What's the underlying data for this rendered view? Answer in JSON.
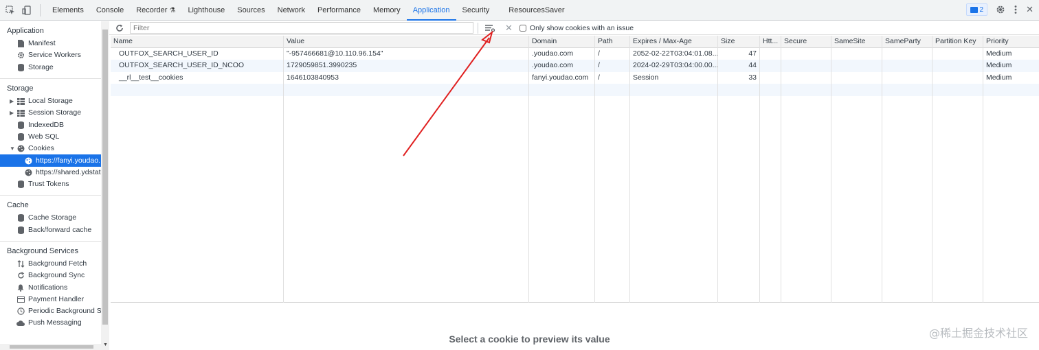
{
  "tabs": [
    {
      "label": "Elements"
    },
    {
      "label": "Console"
    },
    {
      "label": "Recorder"
    },
    {
      "label": "Lighthouse"
    },
    {
      "label": "Sources"
    },
    {
      "label": "Network"
    },
    {
      "label": "Performance"
    },
    {
      "label": "Memory"
    },
    {
      "label": "Application",
      "active": true
    },
    {
      "label": "Security"
    },
    {
      "label": "ResourcesSaver"
    }
  ],
  "issues_badge": "2",
  "sidebar": {
    "application": {
      "title": "Application",
      "items": [
        "Manifest",
        "Service Workers",
        "Storage"
      ]
    },
    "storage": {
      "title": "Storage",
      "items": [
        "Local Storage",
        "Session Storage",
        "IndexedDB",
        "Web SQL",
        "Cookies"
      ],
      "cookie_origins": [
        "https://fanyi.youdao.",
        "https://shared.ydstat"
      ],
      "trust": "Trust Tokens"
    },
    "cache": {
      "title": "Cache",
      "items": [
        "Cache Storage",
        "Back/forward cache"
      ]
    },
    "background": {
      "title": "Background Services",
      "items": [
        "Background Fetch",
        "Background Sync",
        "Notifications",
        "Payment Handler",
        "Periodic Background Sy",
        "Push Messaging"
      ]
    }
  },
  "filter": {
    "placeholder": "Filter",
    "issue_label": "Only show cookies with an issue"
  },
  "table": {
    "headers": [
      "Name",
      "Value",
      "Domain",
      "Path",
      "Expires / Max-Age",
      "Size",
      "Htt...",
      "Secure",
      "SameSite",
      "SameParty",
      "Partition Key",
      "Priority"
    ],
    "rows": [
      [
        "OUTFOX_SEARCH_USER_ID",
        "\"-957466681@10.110.96.154\"",
        ".youdao.com",
        "/",
        "2052-02-22T03:04:01.08...",
        "47",
        "",
        "",
        "",
        "",
        "",
        "Medium"
      ],
      [
        "OUTFOX_SEARCH_USER_ID_NCOO",
        "1729059851.3990235",
        ".youdao.com",
        "/",
        "2024-02-29T03:04:00.00...",
        "44",
        "",
        "",
        "",
        "",
        "",
        "Medium"
      ],
      [
        "__rl__test__cookies",
        "1646103840953",
        "fanyi.youdao.com",
        "/",
        "Session",
        "33",
        "",
        "",
        "",
        "",
        "",
        "Medium"
      ]
    ]
  },
  "preview_text": "Select a cookie to preview its value",
  "watermark": "@稀土掘金技术社区",
  "colors": {
    "accent": "#1a73e8",
    "arrow": "#e02020"
  }
}
